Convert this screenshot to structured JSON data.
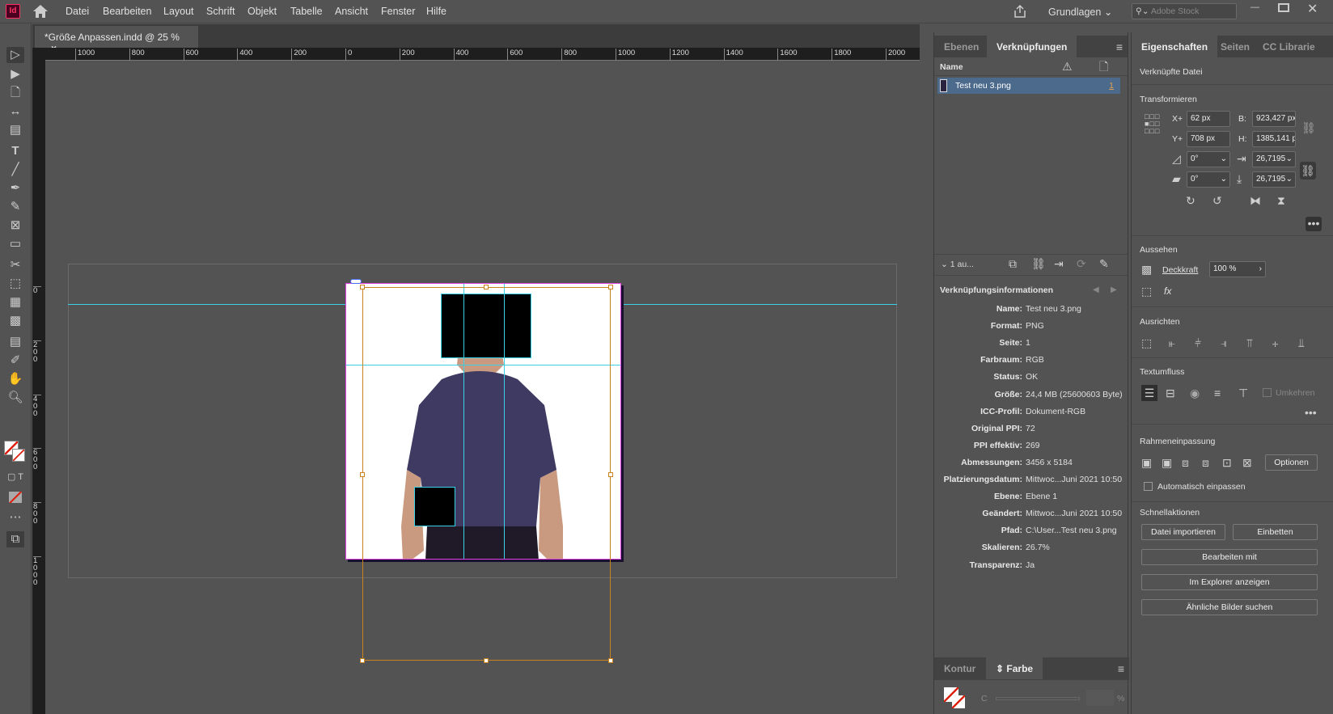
{
  "app": {
    "logo": "Id"
  },
  "menu": [
    "Datei",
    "Bearbeiten",
    "Layout",
    "Schrift",
    "Objekt",
    "Tabelle",
    "Ansicht",
    "Fenster",
    "Hilfe"
  ],
  "topbar": {
    "workspace": "Grundlagen",
    "search_placeholder": "Adobe Stock"
  },
  "document_tab": {
    "title": "*Größe Anpassen.indd @ 25 %",
    "close": "×"
  },
  "rulers": {
    "horizontal": [
      "1000",
      "800",
      "600",
      "400",
      "200",
      "0",
      "200",
      "400",
      "600",
      "800",
      "1000",
      "1200",
      "1400",
      "1600",
      "1800",
      "2000"
    ],
    "vertical": [
      "0",
      "200",
      "400",
      "600",
      "800",
      "1000"
    ]
  },
  "links_panel": {
    "tabs": [
      "Ebenen",
      "Verknüpfungen"
    ],
    "header": {
      "name": "Name"
    },
    "items": [
      {
        "name": "Test neu 3.png",
        "page": "1"
      }
    ],
    "footer_count": "1 au...",
    "info_title": "Verknüpfungsinformationen",
    "info": [
      {
        "k": "Name:",
        "v": "Test neu 3.png"
      },
      {
        "k": "Format:",
        "v": "PNG"
      },
      {
        "k": "Seite:",
        "v": "1"
      },
      {
        "k": "Farbraum:",
        "v": "RGB"
      },
      {
        "k": "Status:",
        "v": "OK"
      },
      {
        "k": "Größe:",
        "v": "24,4 MB (25600603 Byte)"
      },
      {
        "k": "ICC-Profil:",
        "v": "Dokument-RGB"
      },
      {
        "k": "Original PPI:",
        "v": "72"
      },
      {
        "k": "PPI effektiv:",
        "v": "269"
      },
      {
        "k": "Abmessungen:",
        "v": "3456 x 5184"
      },
      {
        "k": "Platzierungsdatum:",
        "v": "Mittwoc...Juni 2021 10:50"
      },
      {
        "k": "Ebene:",
        "v": "Ebene 1"
      },
      {
        "k": "Geändert:",
        "v": "Mittwoc...Juni 2021 10:50"
      },
      {
        "k": "Pfad:",
        "v": "C:\\User...Test neu 3.png"
      },
      {
        "k": "Skalieren:",
        "v": "26.7%"
      },
      {
        "k": "Transparenz:",
        "v": "Ja"
      }
    ]
  },
  "color_panel": {
    "tabs": [
      "Kontur",
      "Farbe"
    ],
    "channel": "C",
    "unit": "%"
  },
  "properties": {
    "tabs": [
      "Eigenschaften",
      "Seiten",
      "CC Librarie"
    ],
    "object_type": "Verknüpfte Datei",
    "transform": {
      "title": "Transformieren",
      "x_label": "X+",
      "x": "62 px",
      "y_label": "Y+",
      "y": "708 px",
      "w_label": "B:",
      "w": "923,427 px",
      "h_label": "H:",
      "h": "1385,141 p",
      "rotation": "0°",
      "shear": "0°",
      "scale_x": "26,7195",
      "scale_y": "26,7195"
    },
    "appearance": {
      "title": "Aussehen",
      "opacity_label": "Deckkraft",
      "opacity": "100 %",
      "fx": "fx"
    },
    "align": {
      "title": "Ausrichten"
    },
    "text_wrap": {
      "title": "Textumfluss",
      "invert": "Umkehren"
    },
    "frame_fitting": {
      "title": "Rahmeneinpassung",
      "options": "Optionen",
      "auto_fit": "Automatisch einpassen"
    },
    "quick_actions": {
      "title": "Schnellaktionen",
      "buttons": [
        "Datei importieren",
        "Einbetten",
        "Bearbeiten mit",
        "Im Explorer anzeigen",
        "Ähnliche Bilder suchen"
      ]
    }
  },
  "colors": {
    "accent": "#4b6a8c",
    "guide": "#3ad0e8",
    "frame": "#c8821e",
    "page_border": "#e040e0"
  }
}
